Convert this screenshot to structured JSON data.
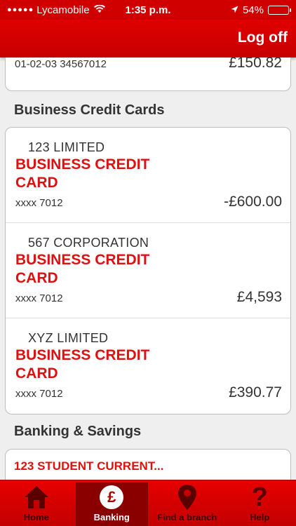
{
  "status_bar": {
    "carrier": "Lycamobile",
    "time": "1:35 p.m.",
    "battery": "54%",
    "battery_level": 0.54
  },
  "nav": {
    "logoff_label": "Log off"
  },
  "top_account": {
    "account_number": "01-02-03 34567012",
    "balance": "£150.82"
  },
  "sections": {
    "credit_cards_title": "Business Credit Cards",
    "savings_title": "Banking & Savings"
  },
  "credit_cards": [
    {
      "company": "123 LIMITED",
      "product_line1": "BUSINESS CREDIT",
      "product_line2": "CARD",
      "masked": "xxxx 7012",
      "balance": "-£600.00"
    },
    {
      "company": "567 CORPORATION",
      "product_line1": "BUSINESS CREDIT",
      "product_line2": "CARD",
      "masked": "xxxx 7012",
      "balance": "£4,593"
    },
    {
      "company": "XYZ LIMITED",
      "product_line1": "BUSINESS CREDIT",
      "product_line2": "CARD",
      "masked": "xxxx 7012",
      "balance": "£390.77"
    }
  ],
  "savings_account": {
    "name": "123 STUDENT CURRENT..."
  },
  "tabs": [
    {
      "label": "Home",
      "icon": "home-icon"
    },
    {
      "label": "Banking",
      "icon": "pound-icon",
      "active": true
    },
    {
      "label": "Find a branch",
      "icon": "location-pin-icon"
    },
    {
      "label": "Help",
      "icon": "help-icon"
    }
  ],
  "colors": {
    "brand_red": "#d00000",
    "product_red": "#e01010",
    "active_tab": "#8a0000"
  }
}
